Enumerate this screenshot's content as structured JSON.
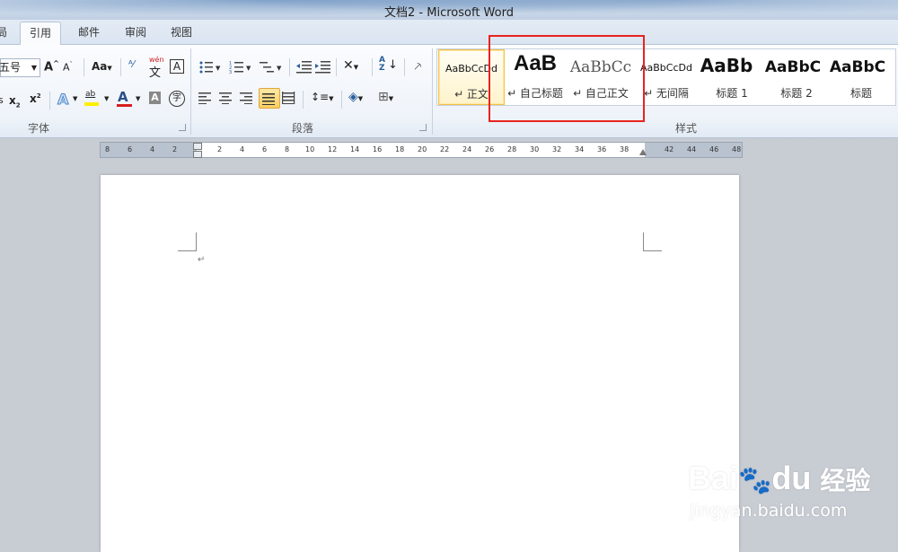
{
  "window": {
    "title": "文档2  -  Microsoft Word"
  },
  "tabs": [
    {
      "label": "局"
    },
    {
      "label": "引用"
    },
    {
      "label": "邮件"
    },
    {
      "label": "审阅"
    },
    {
      "label": "视图"
    }
  ],
  "font_group": {
    "label": "字体",
    "font_size": "五号",
    "change_case": "Aa",
    "wen": "wén",
    "wen_char": "文",
    "highlight": "ab",
    "font_color_glyph": "A",
    "shade_glyph": "A",
    "enclose_glyph": "字",
    "border_glyph": "A"
  },
  "paragraph_group": {
    "label": "段落"
  },
  "styles_group": {
    "label": "样式",
    "items": [
      {
        "sample": "AaBbCcDd",
        "name": "↵ 正文"
      },
      {
        "sample": "AaB",
        "name": "↵ 自己标题"
      },
      {
        "sample": "AaBbCc",
        "name": "↵ 自己正文"
      },
      {
        "sample": "AaBbCcDd",
        "name": "↵ 无间隔"
      },
      {
        "sample": "AaBb",
        "name": "标题 1"
      },
      {
        "sample": "AaBbC",
        "name": "标题 2"
      },
      {
        "sample": "AaBbC",
        "name": "标题"
      }
    ]
  },
  "ruler": {
    "left_ticks": [
      "8",
      "6",
      "4",
      "2"
    ],
    "right_ticks": [
      "2",
      "4",
      "6",
      "8",
      "10",
      "12",
      "14",
      "16",
      "18",
      "20",
      "22",
      "24",
      "26",
      "28",
      "30",
      "32",
      "34",
      "36",
      "38",
      "42",
      "44",
      "46",
      "48"
    ]
  },
  "document": {
    "paragraph_mark": "↵"
  },
  "watermark": {
    "brand_a": "Bai",
    "brand_b": "du",
    "brand_cn": "经验",
    "url": "jingyan.baidu.com"
  },
  "colors": {
    "highlight": "#e8231f",
    "selected_style": "#f2c24c",
    "font_color": "#d81e1e",
    "highlight_color": "#ffee00"
  }
}
